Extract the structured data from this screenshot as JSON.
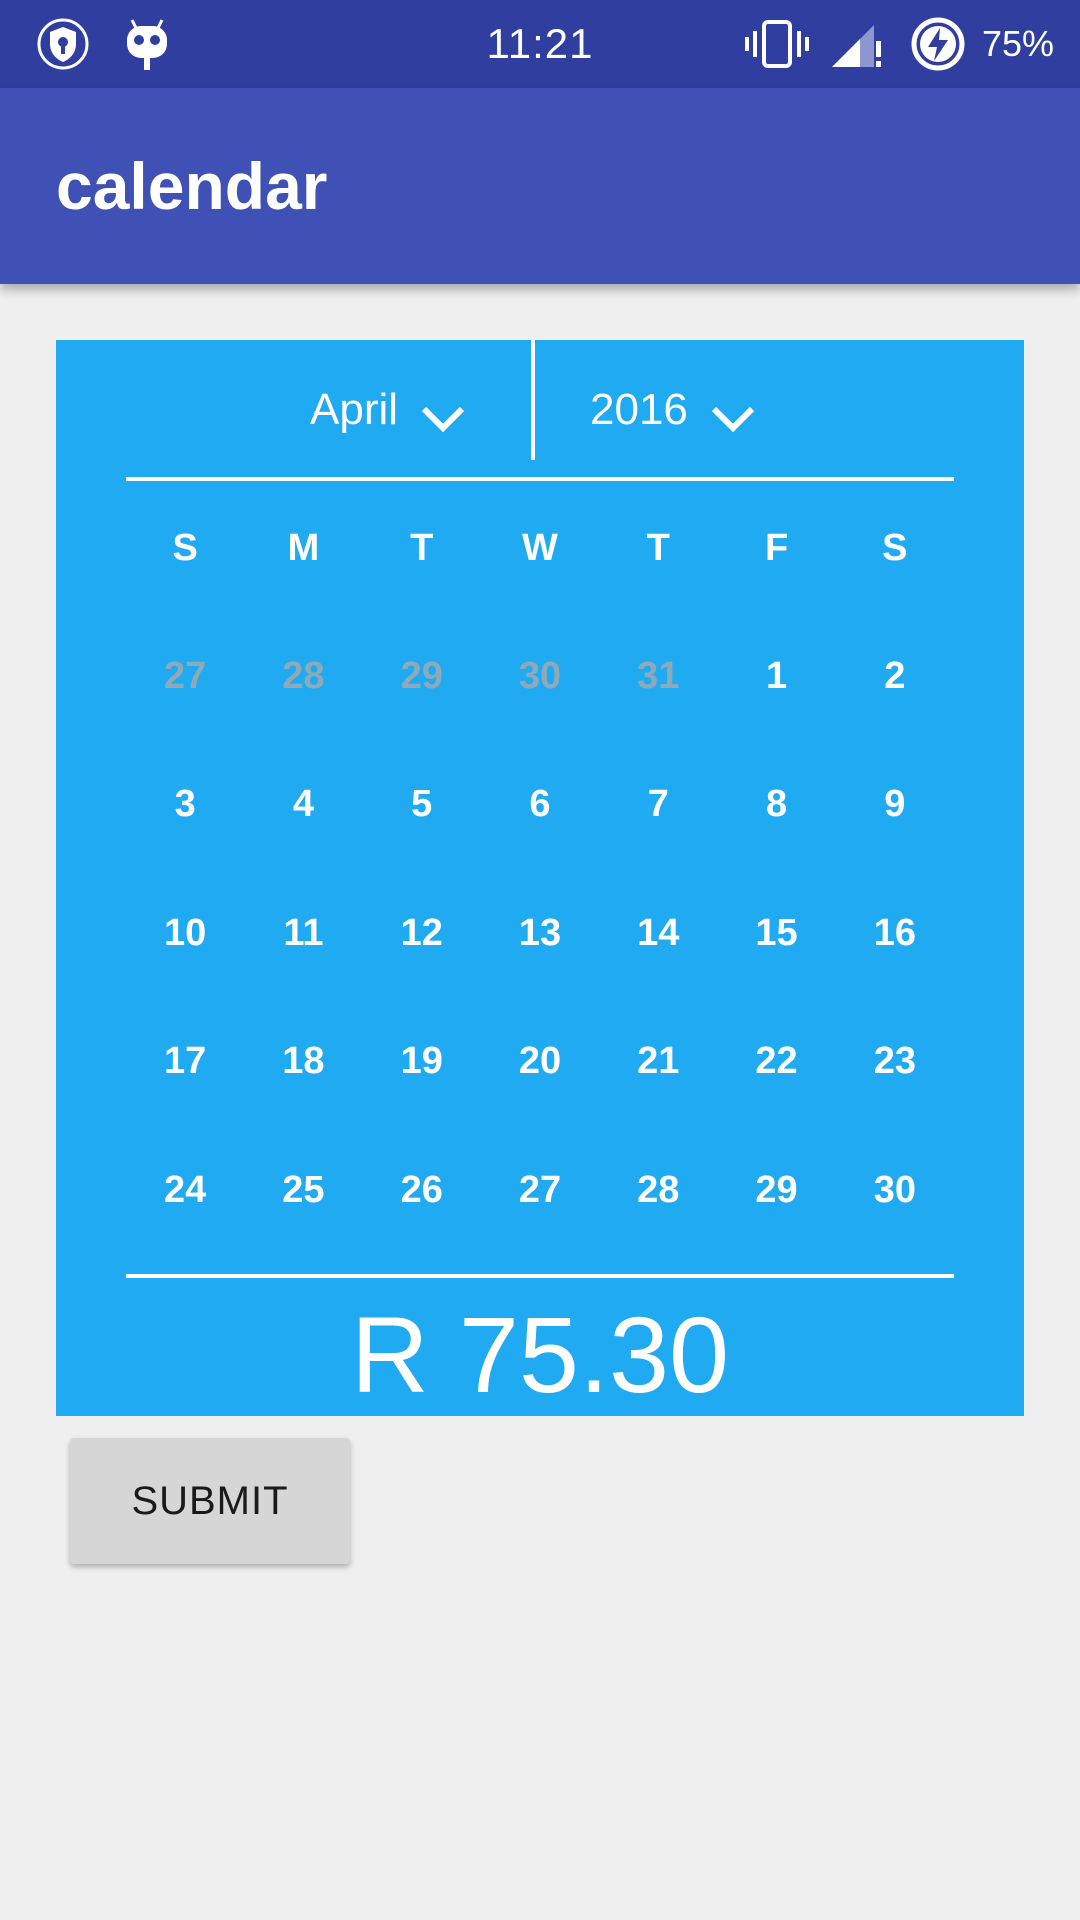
{
  "status_bar": {
    "time": "11:21",
    "battery": "75%",
    "icons": [
      "shield-lock-icon",
      "android-robot-icon",
      "vibrate-icon",
      "signal-icon",
      "battery-charging-icon"
    ]
  },
  "app_bar": {
    "title": "calendar",
    "color": "#3F51B5"
  },
  "calendar": {
    "month": "April",
    "year": "2016",
    "background": "#20AAF2",
    "weekdays": [
      "S",
      "M",
      "T",
      "W",
      "T",
      "F",
      "S"
    ],
    "weeks": [
      [
        "27",
        "28",
        "29",
        "30",
        "31",
        "1",
        "2"
      ],
      [
        "3",
        "4",
        "5",
        "6",
        "7",
        "8",
        "9"
      ],
      [
        "10",
        "11",
        "12",
        "13",
        "14",
        "15",
        "16"
      ],
      [
        "17",
        "18",
        "19",
        "20",
        "21",
        "22",
        "23"
      ],
      [
        "24",
        "25",
        "26",
        "27",
        "28",
        "29",
        "30"
      ]
    ],
    "other_month_days_in_first_week": 5,
    "price": "R 75.30"
  },
  "submit_label": "SUBMIT"
}
